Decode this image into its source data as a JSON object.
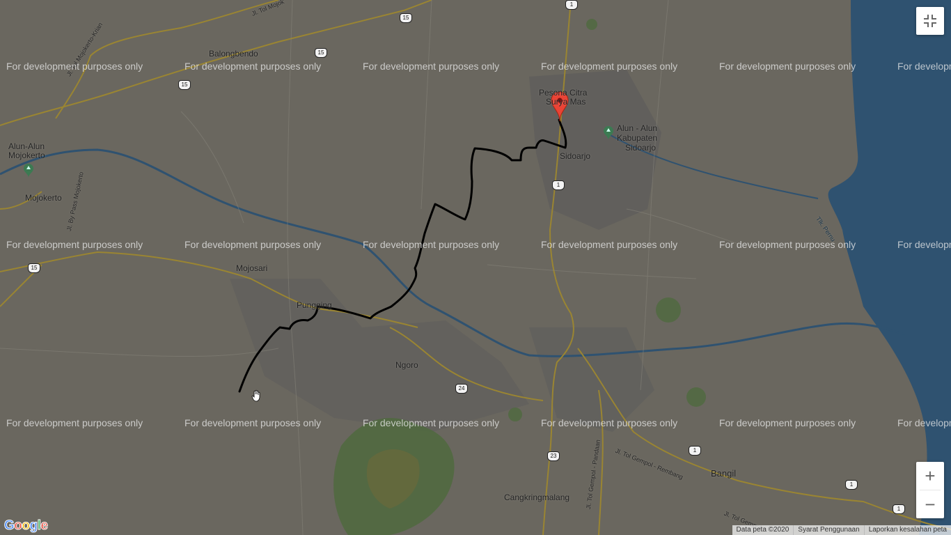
{
  "map": {
    "places": [
      {
        "id": "balongbendo",
        "label": "Balongbendo"
      },
      {
        "id": "alun-mojokerto-1",
        "label": "Alun-Alun"
      },
      {
        "id": "alun-mojokerto-2",
        "label": "Mojokerto"
      },
      {
        "id": "mojokerto",
        "label": "Mojokerto"
      },
      {
        "id": "mojosari",
        "label": "Mojosari"
      },
      {
        "id": "pungging",
        "label": "Pungging"
      },
      {
        "id": "ngoro",
        "label": "Ngoro"
      },
      {
        "id": "pesona-1",
        "label": "Pesona Citra"
      },
      {
        "id": "pesona-2",
        "label": "Surya Mas"
      },
      {
        "id": "alun-sidoarjo-1",
        "label": "Alun - Alun"
      },
      {
        "id": "alun-sidoarjo-2",
        "label": "Kabupaten"
      },
      {
        "id": "alun-sidoarjo-3",
        "label": "Sidoarjo"
      },
      {
        "id": "sidoarjo",
        "label": "Sidoarjo"
      },
      {
        "id": "bangil",
        "label": "Bangil"
      },
      {
        "id": "cangkringmalang",
        "label": "Cangkringmalang"
      }
    ],
    "road_labels": [
      {
        "id": "tol-mojokerto",
        "label": "Jl. Tol Mojok"
      },
      {
        "id": "tol-mojokerto-krian",
        "label": "Jl. Tol Mojokerto-Krian"
      },
      {
        "id": "bypass-mojokerto",
        "label": "Jl. By Pass Mojokerto"
      },
      {
        "id": "tol-gempol-pandaan",
        "label": "Jl. Tol Gempol - Pandaan"
      },
      {
        "id": "tol-gempol-rembang",
        "label": "Jl. Tol Gempol - Rembang"
      },
      {
        "id": "tol-gempol-2",
        "label": "Jl. Tol Gempol -"
      },
      {
        "id": "tlk-pernu",
        "label": "Tlk. Pernu"
      }
    ],
    "shields": [
      "1",
      "15",
      "15",
      "15",
      "15",
      "1",
      "24",
      "23",
      "1",
      "1",
      "1"
    ],
    "watermark": "For development purposes only",
    "marker_icon": "red-location-pin-icon",
    "route_color": "#000000",
    "water_color": "#2f5270"
  },
  "controls": {
    "fullscreen_icon": "exit-fullscreen-icon",
    "zoom_in_label": "+",
    "zoom_out_label": "−"
  },
  "footer": {
    "data": "Data peta ©2020",
    "terms": "Syarat Penggunaan",
    "report": "Laporkan kesalahan peta"
  },
  "logo": {
    "letters": [
      "G",
      "o",
      "o",
      "g",
      "l",
      "e"
    ],
    "colors": [
      "#4285f4",
      "#ea4335",
      "#fbbc05",
      "#4285f4",
      "#34a853",
      "#ea4335"
    ]
  }
}
